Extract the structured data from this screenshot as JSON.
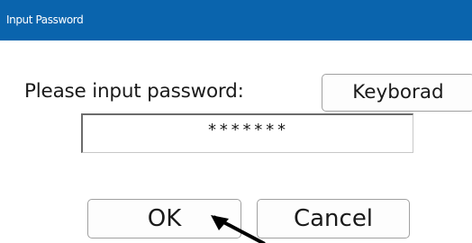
{
  "window": {
    "title": "Input Password"
  },
  "form": {
    "prompt": "Please input password:",
    "keyboard_button": "Keyborad",
    "password_value": "*******"
  },
  "buttons": {
    "ok": "OK",
    "cancel": "Cancel"
  },
  "colors": {
    "titlebar": "#0a64ad",
    "title_text": "#ffffff",
    "window_bg": "#ffffff",
    "button_border": "#a0a0a0"
  },
  "icons": {
    "cursor": "arrow-cursor-icon"
  }
}
